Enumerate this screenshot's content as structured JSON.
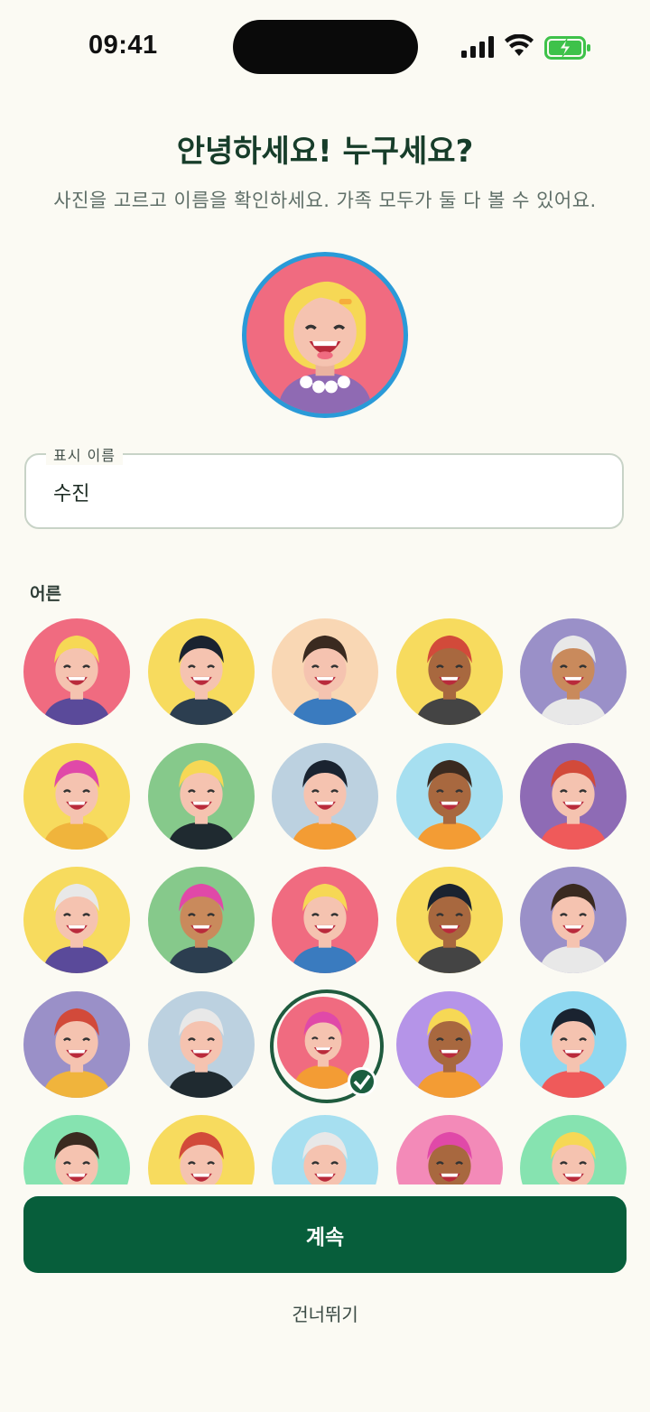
{
  "status": {
    "time": "09:41"
  },
  "header": {
    "title": "안녕하세요! 누구세요?",
    "subtitle": "사진을 고르고 이름을 확인하세요. 가족 모두가 둘 다 볼 수 있어요."
  },
  "name_field": {
    "label": "표시 이름",
    "value": "수진"
  },
  "section": {
    "label": "어른"
  },
  "avatars": [
    {
      "name": "blonde-beard-man",
      "bg": "#f06b80",
      "selected": false
    },
    {
      "name": "glasses-tie-man",
      "bg": "#f7db5e",
      "selected": false
    },
    {
      "name": "bald-mustache-man",
      "bg": "#f9d7b4",
      "selected": false
    },
    {
      "name": "beret-sunglasses-man",
      "bg": "#f7db5e",
      "selected": false
    },
    {
      "name": "keffiyeh-man",
      "bg": "#9a90c8",
      "selected": false
    },
    {
      "name": "beanie-beard-man",
      "bg": "#f7db5e",
      "selected": false
    },
    {
      "name": "cap-turtleneck-man",
      "bg": "#86c98b",
      "selected": false
    },
    {
      "name": "turban-beard-man",
      "bg": "#bcd1e0",
      "selected": false
    },
    {
      "name": "redhead-glasses-man",
      "bg": "#a6dff0",
      "selected": false
    },
    {
      "name": "blonde-glasses-man",
      "bg": "#8e6bb5",
      "selected": false
    },
    {
      "name": "grandpa-glasses",
      "bg": "#f7db5e",
      "selected": false
    },
    {
      "name": "pink-hair-woman",
      "bg": "#86c98b",
      "selected": false
    },
    {
      "name": "headband-woman",
      "bg": "#f06b80",
      "selected": false
    },
    {
      "name": "hijab-woman",
      "bg": "#f7db5e",
      "selected": false
    },
    {
      "name": "blonde-sunglasses-woman",
      "bg": "#9a90c8",
      "selected": false
    },
    {
      "name": "blonde-ponytail-woman",
      "bg": "#9a90c8",
      "selected": false
    },
    {
      "name": "grandma-glasses",
      "bg": "#bcd1e0",
      "selected": false
    },
    {
      "name": "blonde-clip-woman",
      "bg": "#f06b80",
      "selected": true
    },
    {
      "name": "curly-hair-woman",
      "bg": "#b594e8",
      "selected": false
    },
    {
      "name": "beard-man-green",
      "bg": "#8fd8f0",
      "selected": false
    },
    {
      "name": "bob-hair-woman",
      "bg": "#86e3b0",
      "selected": false
    },
    {
      "name": "round-glasses-man",
      "bg": "#f7db5e",
      "selected": false
    },
    {
      "name": "dark-hair-woman",
      "bg": "#a6dff0",
      "selected": false
    },
    {
      "name": "mustache-man",
      "bg": "#f38ab8",
      "selected": false
    },
    {
      "name": "curly-earrings-woman",
      "bg": "#86e3b0",
      "selected": false
    }
  ],
  "actions": {
    "continue": "계속",
    "skip": "건너뛰기"
  },
  "colors": {
    "primary": "#075e3b",
    "background": "#fbfaf3",
    "hero_ring": "#2a9ad8"
  }
}
